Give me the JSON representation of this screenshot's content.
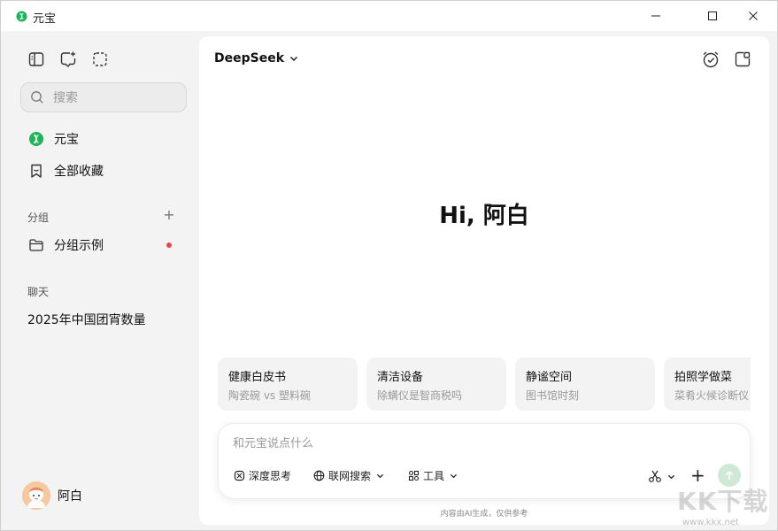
{
  "window": {
    "title": "元宝"
  },
  "sidebar": {
    "search_placeholder": "搜索",
    "nav": [
      {
        "label": "元宝",
        "icon": "yuanbao-logo-icon"
      },
      {
        "label": "全部收藏",
        "icon": "bookmark-icon"
      }
    ],
    "groups_label": "分组",
    "group_items": [
      {
        "label": "分组示例",
        "icon": "folder-icon",
        "badge_color": "#e5484d"
      }
    ],
    "chats_label": "聊天",
    "chat_items": [
      {
        "label": "2025年中国团宵数量"
      }
    ],
    "user": {
      "name": "阿白"
    }
  },
  "main": {
    "model": "DeepSeek",
    "greeting": "Hi, 阿白",
    "cards": [
      {
        "title": "健康白皮书",
        "subtitle": "陶瓷碗 vs 塑料碗"
      },
      {
        "title": "清洁设备",
        "subtitle": "除螨仪是智商税吗"
      },
      {
        "title": "静谧空间",
        "subtitle": "图书馆时刻"
      },
      {
        "title": "拍照学做菜",
        "subtitle": "菜肴火候诊断仪"
      }
    ],
    "composer": {
      "placeholder": "和元宝说点什么",
      "tools": {
        "deep_think": "深度思考",
        "web_search": "联网搜索",
        "tools": "工具"
      }
    },
    "disclaimer": "内容由AI生成，仅供参考"
  },
  "watermark": {
    "text": "KK下载",
    "url": "www.kkx.net"
  },
  "colors": {
    "accent_green": "#1fb35a",
    "badge_red": "#e5484d",
    "send_bg": "#cfe9d6"
  }
}
